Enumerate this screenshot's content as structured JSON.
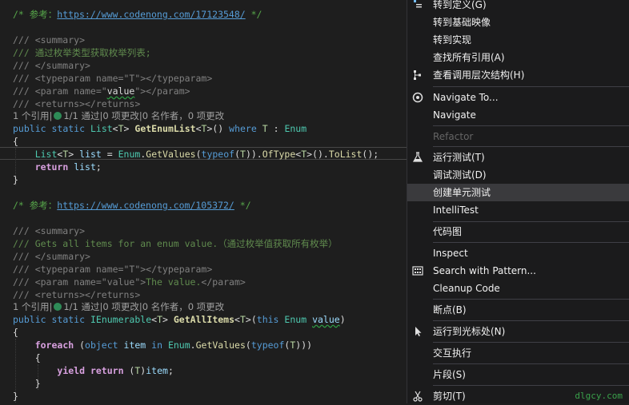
{
  "editor": {
    "ref1_prefix": "/* 参考：",
    "ref1_url": "https://www.codenong.com/17123548/",
    "ref1_suffix": " */",
    "ref2_prefix": "/* 参考：",
    "ref2_url": "https://www.codenong.com/105372/",
    "ref2_suffix": " */",
    "lens_refs": "1 个引用|",
    "lens_tests": "1/1 通过|0 项更改|0 名作者，0 项更改",
    "m1_doc_summary_open": "/// <summary>",
    "m1_doc_summary_text": "/// 通过枚举类型获取枚举列表;",
    "m1_doc_summary_close": "/// </summary>",
    "m1_doc_typeparam": "/// <typeparam name=\"T\"></typeparam>",
    "m1_doc_param_pre": "/// <param name=\"",
    "m1_doc_param_name": "value",
    "m1_doc_param_post": "\"></param>",
    "m1_doc_returns": "/// <returns></returns>",
    "m2_doc_summary_open": "/// <summary>",
    "m2_doc_summary_text": "/// Gets all items for an enum value.（通过枚举值获取所有枚举）",
    "m2_doc_summary_close": "/// </summary>",
    "m2_doc_typeparam": "/// <typeparam name=\"T\"></typeparam>",
    "m2_doc_param_pre": "/// <param name=\"value\">",
    "m2_doc_param_text": "The value.",
    "m2_doc_param_post": "</param>",
    "m2_doc_returns": "/// <returns></returns>",
    "brace_open": "{",
    "brace_close": "}"
  },
  "menu": {
    "items": [
      {
        "label": "转到定义(G)",
        "icon": "go-to-definition-icon"
      },
      {
        "label": "转到基础映像",
        "icon": ""
      },
      {
        "label": "转到实现",
        "icon": ""
      },
      {
        "label": "查找所有引用(A)",
        "icon": ""
      },
      {
        "label": "查看调用层次结构(H)",
        "icon": "call-hierarchy-icon"
      },
      {
        "label": "Navigate To...",
        "icon": "navigate-to-icon"
      },
      {
        "label": "Navigate",
        "icon": ""
      },
      {
        "label": "Refactor",
        "icon": ""
      },
      {
        "label": "运行测试(T)",
        "icon": "run-tests-icon"
      },
      {
        "label": "调试测试(D)",
        "icon": ""
      },
      {
        "label": "创建单元测试",
        "icon": ""
      },
      {
        "label": "IntelliTest",
        "icon": ""
      },
      {
        "label": "代码图",
        "icon": ""
      },
      {
        "label": "Inspect",
        "icon": ""
      },
      {
        "label": "Search with Pattern...",
        "icon": "search-pattern-icon"
      },
      {
        "label": "Cleanup Code",
        "icon": ""
      },
      {
        "label": "断点(B)",
        "icon": ""
      },
      {
        "label": "运行到光标处(N)",
        "icon": "run-to-cursor-icon"
      },
      {
        "label": "交互执行",
        "icon": ""
      },
      {
        "label": "片段(S)",
        "icon": ""
      },
      {
        "label": "剪切(T)",
        "icon": "cut-icon"
      }
    ]
  },
  "watermark": "dlgcy.com"
}
